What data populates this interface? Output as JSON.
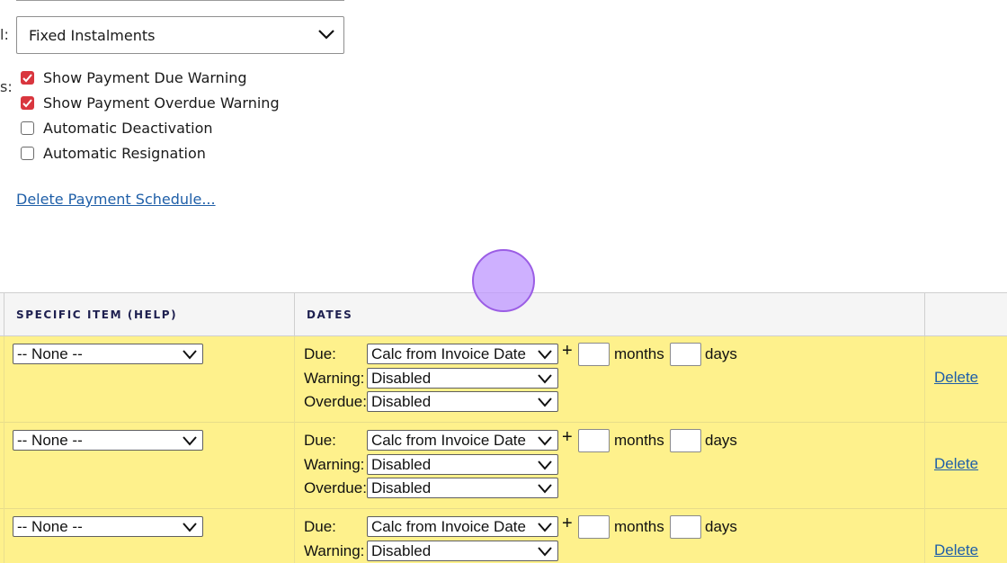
{
  "form": {
    "method_label_tail": "l:",
    "method_value": "Fixed Instalments",
    "options_label_tail": "s:",
    "options": [
      {
        "label": "Show Payment Due Warning",
        "checked": true
      },
      {
        "label": "Show Payment Overdue Warning",
        "checked": true
      },
      {
        "label": "Automatic Deactivation",
        "checked": false
      },
      {
        "label": "Automatic Resignation",
        "checked": false
      }
    ],
    "delete_schedule_link": "Delete Payment Schedule..."
  },
  "table": {
    "headers": {
      "specific_item": "SPECIFIC ITEM (HELP)",
      "dates": "DATES"
    },
    "row_labels": {
      "due": "Due:",
      "warning": "Warning:",
      "overdue": "Overdue:",
      "months": "months",
      "days": "days",
      "plus": "+"
    },
    "rows": [
      {
        "item": "-- None --",
        "due": "Calc from Invoice Date",
        "warning": "Disabled",
        "overdue": "Disabled",
        "delete": "Delete"
      },
      {
        "item": "-- None --",
        "due": "Calc from Invoice Date",
        "warning": "Disabled",
        "overdue": "Disabled",
        "delete": "Delete"
      },
      {
        "item": "-- None --",
        "due": "Calc from Invoice Date",
        "warning": "Disabled",
        "delete": "Delete"
      }
    ]
  },
  "colors": {
    "row_bg": "#fef18c",
    "link": "#1f5fa8",
    "check_on": "#d9363e",
    "header_text": "#1e2050"
  }
}
